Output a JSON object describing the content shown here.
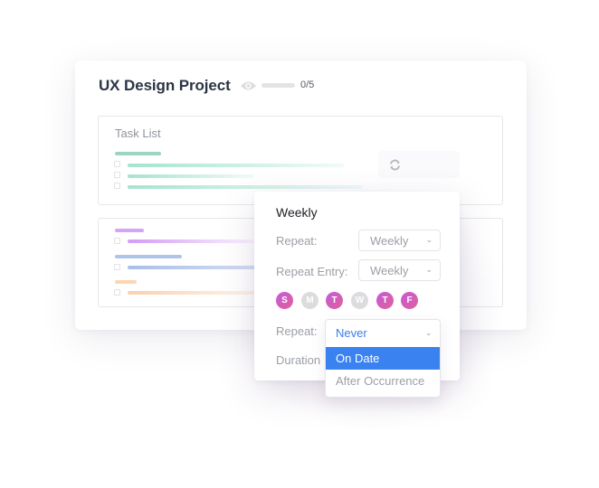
{
  "project": {
    "title": "UX Design Project",
    "progress_text": "0/5",
    "progress_fraction": 0,
    "eye_icon": "eye-icon"
  },
  "task_list": {
    "title": "Task List",
    "accent_color": "#8fd3c0",
    "tasks": [
      {
        "checked": false
      },
      {
        "checked": false
      },
      {
        "checked": false
      }
    ]
  },
  "task_groups": [
    {
      "color": "#d39cf5",
      "tasks": [
        {
          "checked": false
        }
      ]
    },
    {
      "color": "#a9bfe9",
      "tasks": [
        {
          "checked": false
        }
      ]
    },
    {
      "color": "#fbd3ae",
      "tasks": [
        {
          "checked": false
        }
      ]
    }
  ],
  "refresh": {
    "icon": "refresh-icon"
  },
  "popup": {
    "title": "Weekly",
    "repeat_label": "Repeat:",
    "repeat_value": "Weekly",
    "repeat_entry_label": "Repeat Entry:",
    "repeat_entry_value": "Weekly",
    "days": [
      {
        "label": "S",
        "selected": true
      },
      {
        "label": "M",
        "selected": false
      },
      {
        "label": "T",
        "selected": true
      },
      {
        "label": "W",
        "selected": false
      },
      {
        "label": "T",
        "selected": true
      },
      {
        "label": "F",
        "selected": true
      }
    ],
    "end_repeat_label": "Repeat:",
    "duration_label": "Duration",
    "end_dropdown": {
      "current": "Never",
      "options": [
        "On Date",
        "After Occurrence"
      ],
      "highlighted": "On Date"
    },
    "chevron_glyph": "⌄"
  },
  "colors": {
    "accent_blue": "#3a82f0",
    "day_on_start": "#c45bd8",
    "day_on_end": "#e0609a",
    "day_off": "#dcdcde"
  }
}
